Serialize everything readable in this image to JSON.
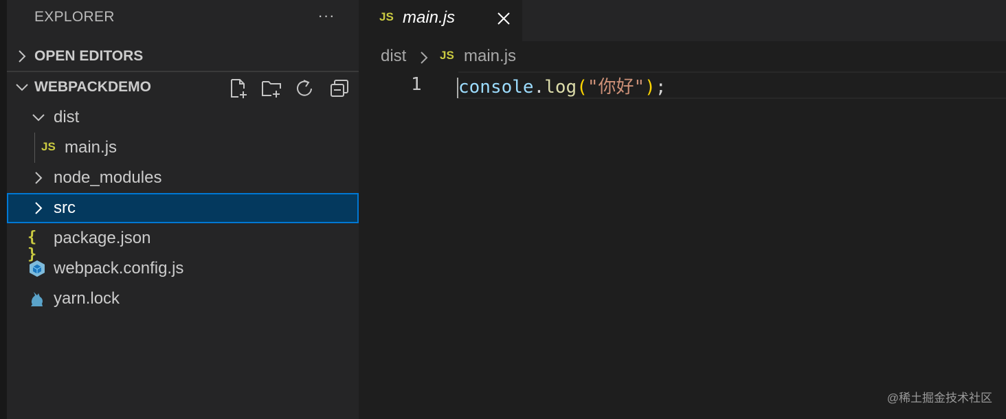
{
  "sidebar": {
    "title": "EXPLORER",
    "more_label": "···",
    "open_editors_label": "OPEN EDITORS",
    "project_label": "WEBPACKDEMO",
    "actions": [
      {
        "name": "new-file-icon"
      },
      {
        "name": "new-folder-icon"
      },
      {
        "name": "refresh-icon"
      },
      {
        "name": "collapse-all-icon"
      }
    ],
    "tree": [
      {
        "label": "dist",
        "type": "folder",
        "expanded": true
      },
      {
        "label": "main.js",
        "type": "file",
        "icon": "js-icon",
        "icon_text": "JS"
      },
      {
        "label": "node_modules",
        "type": "folder",
        "expanded": false
      },
      {
        "label": "src",
        "type": "folder",
        "expanded": false,
        "selected": true
      },
      {
        "label": "package.json",
        "type": "file",
        "icon": "json-icon",
        "icon_text": "{ }"
      },
      {
        "label": "webpack.config.js",
        "type": "file",
        "icon": "webpack-icon"
      },
      {
        "label": "yarn.lock",
        "type": "file",
        "icon": "yarn-icon"
      }
    ]
  },
  "editor": {
    "tab": {
      "icon_text": "JS",
      "label": "main.js"
    },
    "breadcrumb": {
      "folder": "dist",
      "icon_text": "JS",
      "file": "main.js"
    },
    "line_number": "1",
    "code": {
      "obj": "console",
      "dot": ".",
      "fn": "log",
      "open_paren": "(",
      "string": "\"你好\"",
      "close_paren": ")",
      "semi": ";"
    }
  },
  "watermark": "@稀土掘金技术社区",
  "colors": {
    "sidebar_bg": "#252526",
    "editor_bg": "#1e1e1e",
    "selection_bg": "#04395e",
    "selection_border": "#0078d4",
    "js_yellow": "#cbcb41"
  }
}
